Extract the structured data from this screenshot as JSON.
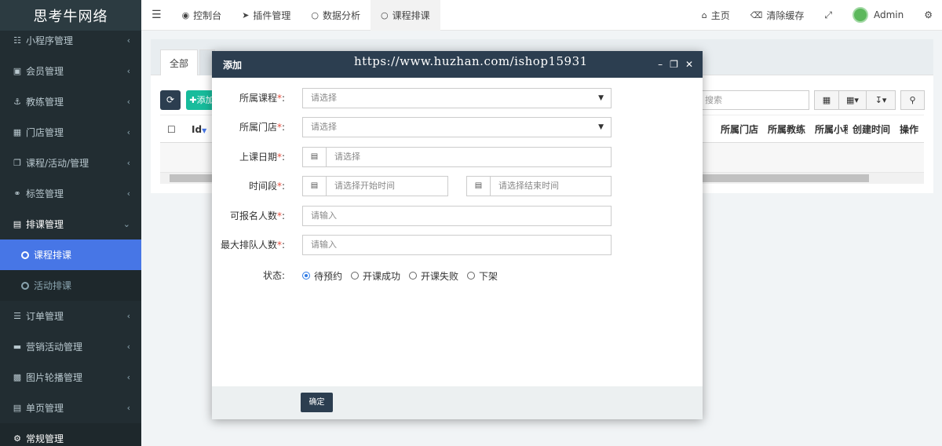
{
  "brand": "思考牛网络",
  "sidebar": {
    "items": [
      {
        "label": "小程序管理",
        "icon": "sitemap-icon"
      },
      {
        "label": "会员管理",
        "icon": "id-card-icon"
      },
      {
        "label": "教练管理",
        "icon": "anchor-icon"
      },
      {
        "label": "门店管理",
        "icon": "store-icon"
      },
      {
        "label": "课程/活动/管理",
        "icon": "copy-icon"
      },
      {
        "label": "标签管理",
        "icon": "link-icon"
      },
      {
        "label": "排课管理",
        "icon": "calendar-icon"
      }
    ],
    "sub_items": [
      {
        "label": "课程排课"
      },
      {
        "label": "活动排课"
      }
    ],
    "items2": [
      {
        "label": "订单管理",
        "icon": "database-icon"
      },
      {
        "label": "营销活动管理",
        "icon": "visa-icon"
      },
      {
        "label": "图片轮播管理",
        "icon": "image-icon"
      },
      {
        "label": "单页管理",
        "icon": "file-icon"
      },
      {
        "label": "常规管理",
        "icon": "cogs-icon"
      }
    ]
  },
  "header": {
    "tabs": [
      {
        "label": "控制台",
        "icon": "dashboard-icon"
      },
      {
        "label": "插件管理",
        "icon": "rocket-icon"
      },
      {
        "label": "数据分析",
        "icon": "circle-icon"
      },
      {
        "label": "课程排课",
        "icon": "circle-icon"
      }
    ],
    "home": "主页",
    "clear_cache": "清除缓存",
    "user": "Admin"
  },
  "panel": {
    "tab_all": "全部",
    "add_label": "添加",
    "search_placeholder": "搜索",
    "columns": [
      "Id",
      "所属门店",
      "所属教练",
      "所属小程",
      "创建时间",
      "操作"
    ]
  },
  "modal": {
    "title": "添加",
    "watermark": "https://www.huzhan.com/ishop15931",
    "fields": {
      "course": {
        "label": "所属课程",
        "placeholder": "请选择"
      },
      "store": {
        "label": "所属门店",
        "placeholder": "请选择"
      },
      "date": {
        "label": "上课日期",
        "placeholder": "请选择"
      },
      "time": {
        "label": "时间段",
        "start_placeholder": "请选择开始时间",
        "end_placeholder": "请选择结束时间"
      },
      "capacity": {
        "label": "可报名人数",
        "placeholder": "请输入"
      },
      "queue": {
        "label": "最大排队人数",
        "placeholder": "请输入"
      },
      "status": {
        "label": "状态",
        "options": [
          "待预约",
          "开课成功",
          "开课失败",
          "下架"
        ],
        "selected": "待预约"
      }
    },
    "ok_label": "确定"
  },
  "colors": {
    "sidebar_bg": "#222d32",
    "active_blue": "#4776e6",
    "modal_head": "#2c3e50",
    "add_green": "#18bc9c",
    "required_red": "#e74c3c"
  }
}
